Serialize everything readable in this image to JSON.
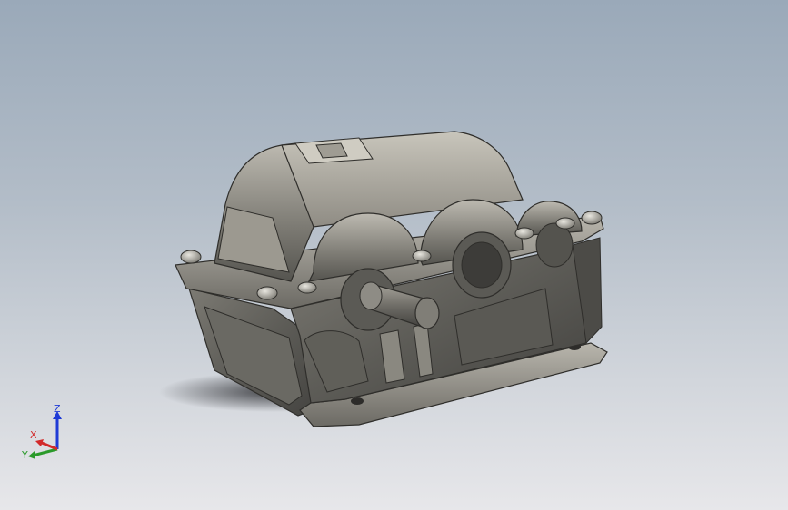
{
  "viewport": {
    "background_top": "#9aa9b9",
    "background_bottom": "#e7e7ea",
    "model_name": "gear-reducer-housing"
  },
  "triad": {
    "z_label": "Z",
    "x_label": "X",
    "y_label": "Y",
    "z_color": "#1f3bd6",
    "x_color": "#d22a2a",
    "y_color": "#2a9a2a"
  }
}
